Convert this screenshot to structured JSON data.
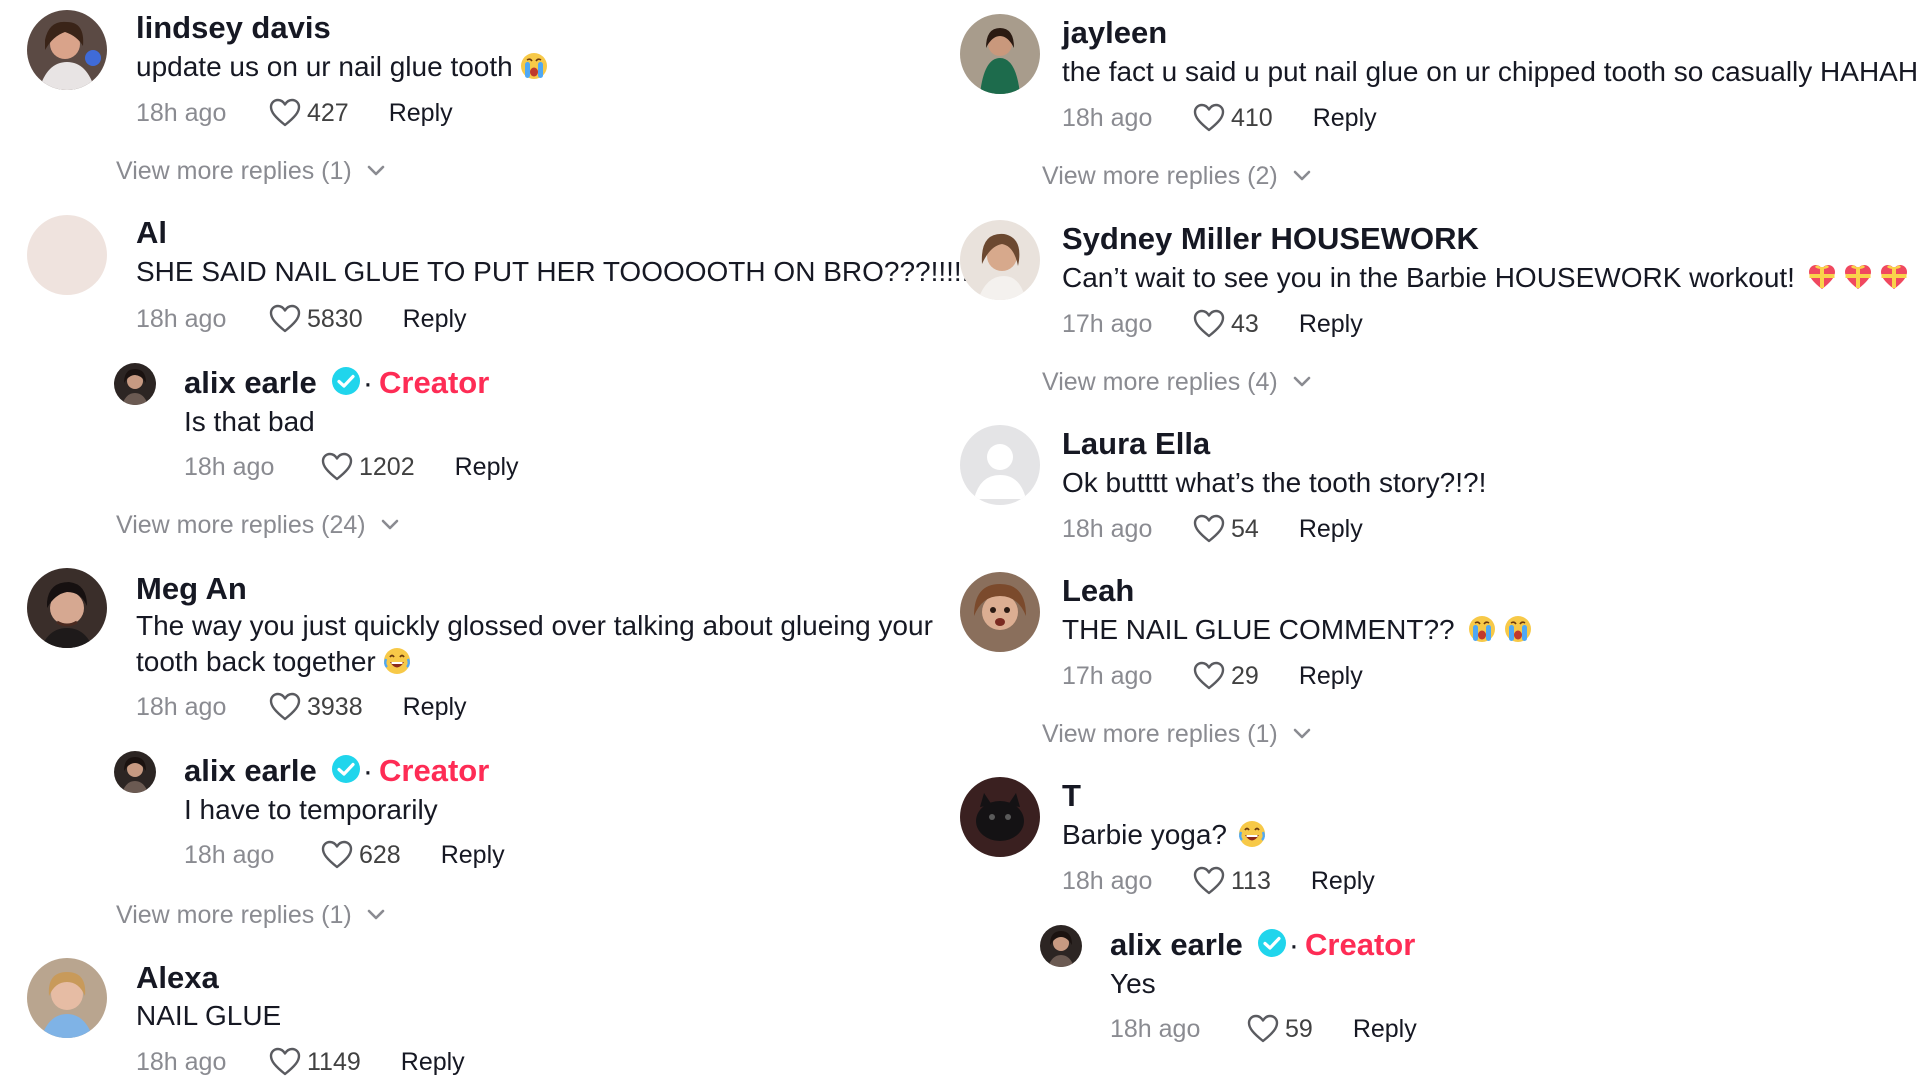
{
  "creator_label": "Creator",
  "reply_label": "Reply",
  "comments": {
    "c1": {
      "username": "lindsey davis",
      "text": "update us on ur nail glue tooth",
      "emoji": "crying-face",
      "time": "18h ago",
      "likes": "427",
      "more": "View more replies (1)"
    },
    "c2": {
      "username": "Al",
      "text": "SHE SAID NAIL GLUE TO PUT HER TOOOOOTH ON BRO???!!!!!!",
      "time": "18h ago",
      "likes": "5830",
      "reply": {
        "username": "alix earle",
        "text": "Is that bad",
        "time": "18h ago",
        "likes": "1202"
      },
      "more": "View more replies (24)"
    },
    "c3": {
      "username": "Meg An",
      "text": "The way you just quickly glossed over talking about glueing your tooth back together",
      "emoji": "laughing-face",
      "time": "18h ago",
      "likes": "3938",
      "reply": {
        "username": "alix earle",
        "text": "I have to temporarily",
        "time": "18h ago",
        "likes": "628"
      },
      "more": "View more replies (1)"
    },
    "c4": {
      "username": "Alexa",
      "text": "NAIL GLUE",
      "time": "18h ago",
      "likes": "1149"
    },
    "c5": {
      "username": "jayleen",
      "text": "the fact u said u put nail glue on ur chipped tooth so casually HAHAH",
      "time": "18h ago",
      "likes": "410",
      "more": "View more replies (2)"
    },
    "c6": {
      "username": "Sydney Miller HOUSEWORK",
      "text": "Can’t wait to see you in the Barbie HOUSEWORK workout!",
      "emoji": "heart-with-ribbon",
      "time": "17h ago",
      "likes": "43",
      "more": "View more replies (4)"
    },
    "c7": {
      "username": "Laura Ella",
      "text": "Ok butttt what’s the tooth story?!?!",
      "time": "18h ago",
      "likes": "54"
    },
    "c8": {
      "username": "Leah",
      "text": "THE NAIL GLUE COMMENT??",
      "emoji": "crying-face",
      "time": "17h ago",
      "likes": "29",
      "more": "View more replies (1)"
    },
    "c9": {
      "username": "T",
      "text": "Barbie yoga?",
      "emoji": "laughing-face",
      "time": "18h ago",
      "likes": "113",
      "reply": {
        "username": "alix earle",
        "text": "Yes",
        "time": "18h ago",
        "likes": "59"
      }
    }
  },
  "colors": {
    "accent": "#fe2c55",
    "verified": "#20d5ec",
    "muted": "#8a8b91",
    "text": "#161823"
  }
}
